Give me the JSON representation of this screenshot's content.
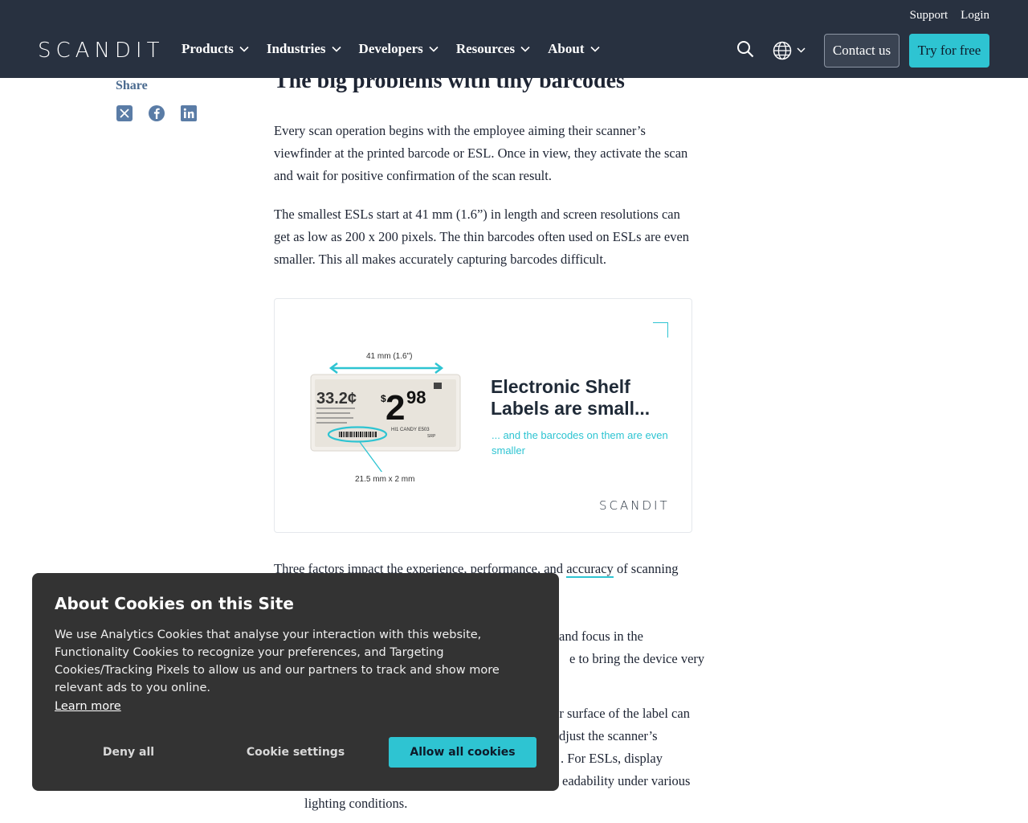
{
  "header": {
    "top_links": [
      "Support",
      "Login"
    ],
    "logo": "SCANDIT",
    "nav": [
      "Products",
      "Industries",
      "Developers",
      "Resources",
      "About"
    ],
    "contact_label": "Contact us",
    "try_label": "Try for free"
  },
  "share": {
    "label": "Share",
    "icons": [
      "x-twitter-icon",
      "facebook-icon",
      "linkedin-icon"
    ]
  },
  "article": {
    "title": "The big problems with tiny barcodes",
    "p1": "Every scan operation begins with the employee aiming their scanner’s viewfinder at the printed barcode or ESL. Once in view, they activate the scan and wait for positive confirmation of the scan result.",
    "p2": "The smallest ESLs start at 41 mm (1.6”) in length and screen resolutions can get as low as 200 x 200 pixels. The thin barcodes often used on ESLs are even smaller. This all makes accurately capturing barcodes difficult.",
    "p3_before": "Three factors impact the experience, performance, and ",
    "p3_link": "accuracy",
    "p3_after": " of scanning",
    "b1_line1": "and focus in the",
    "b1_line2": "e to bring the device very",
    "b2_line1": "er surface of the label can",
    "b2_line2": "djust the scanner’s",
    "b2_line3": ". For ESLs, display",
    "b2_line4": "eadability under various",
    "b2_line5": "lighting conditions."
  },
  "figure": {
    "dim_top": "41 mm (1.6\")",
    "dim_bottom": "21.5 mm x 2 mm",
    "heading": "Electronic Shelf Labels are small...",
    "sub": "... and the barcodes on them are even smaller",
    "logo": "SCANDIT",
    "label_price_left": "33.2¢",
    "label_price_dollar": "$",
    "label_price_main": "2",
    "label_price_cents": "98",
    "label_product": "HI1 CANDY E503",
    "label_srp": "SRP"
  },
  "cookie": {
    "title": "About Cookies on this Site",
    "body": "We use Analytics Cookies that analyse your interaction with this website, Functionality Cookies to recognize your preferences, and Targeting Cookies/Tracking Pixels to allow us and our partners to track and show more relevant ads to you online.",
    "learn_more": "Learn more",
    "deny": "Deny all",
    "settings": "Cookie settings",
    "allow": "Allow all cookies"
  },
  "colors": {
    "header_bg": "#283140",
    "accent": "#2ec4d2",
    "cookie_bg": "#333333"
  }
}
